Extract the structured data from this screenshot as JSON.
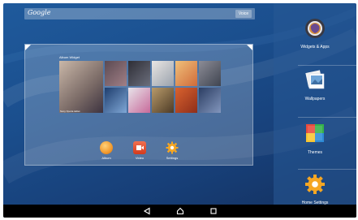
{
  "search": {
    "label": "Google",
    "button": "Voice"
  },
  "preview": {
    "album_header": "Album Widget",
    "tiles": [
      {
        "caption": "Sony Xperia tablet"
      },
      {
        "caption": ""
      },
      {
        "caption": ""
      },
      {
        "caption": ""
      },
      {
        "caption": ""
      },
      {
        "caption": ""
      },
      {
        "caption": ""
      },
      {
        "caption": ""
      },
      {
        "caption": ""
      },
      {
        "caption": ""
      },
      {
        "caption": ""
      }
    ],
    "dock": [
      {
        "label": "Album"
      },
      {
        "label": "Video"
      },
      {
        "label": "Settings"
      }
    ]
  },
  "side_menu": {
    "items": [
      {
        "label": "Widgets & Apps"
      },
      {
        "label": "Wallpapers"
      },
      {
        "label": "Themes"
      },
      {
        "label": "Home Settings"
      }
    ]
  },
  "colors": {
    "wallpaper": "#1b4f8e",
    "album_orange": "#f29a2e",
    "video_red": "#e24a2c",
    "navbar": "#000000"
  }
}
